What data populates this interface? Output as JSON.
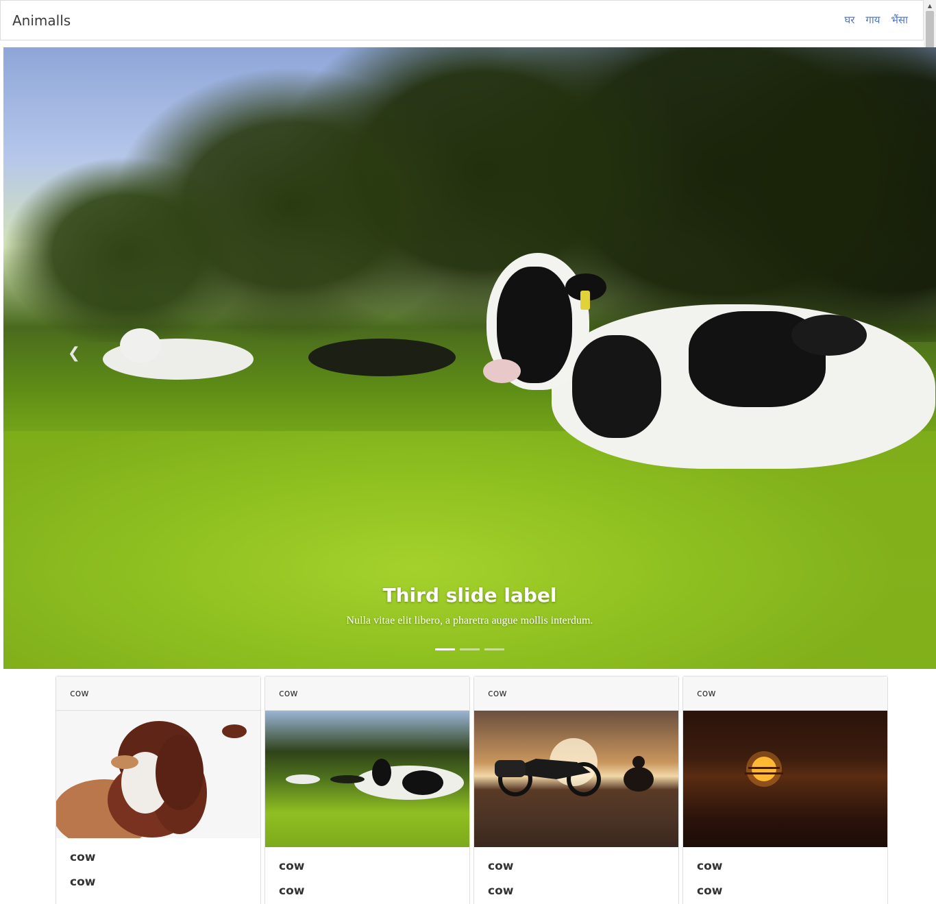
{
  "navbar": {
    "brand": "Animalls",
    "links": [
      "घर",
      "गाय",
      "भैंसा"
    ]
  },
  "carousel": {
    "caption_title": "Third slide label",
    "caption_text": "Nulla vitae elit libero, a pharetra augue mollis interdum.",
    "indicator_count": 3,
    "active_index": 0,
    "prev_icon": "chevron-left-icon"
  },
  "cards": [
    {
      "header": "cow",
      "title": "cow",
      "text": "cow",
      "image": "two-cows-embracing"
    },
    {
      "header": "cow",
      "title": "cow",
      "text": "cow",
      "image": "cows-lying-in-field"
    },
    {
      "header": "cow",
      "title": "cow",
      "text": "cow",
      "image": "motorcycle-at-sunset"
    },
    {
      "header": "cow",
      "title": "cow",
      "text": "cow",
      "image": "sun-setting-behind-clouds"
    }
  ],
  "colors": {
    "link": "#4a78c4",
    "header_bg": "#f7f7f7",
    "border": "#dedede"
  }
}
